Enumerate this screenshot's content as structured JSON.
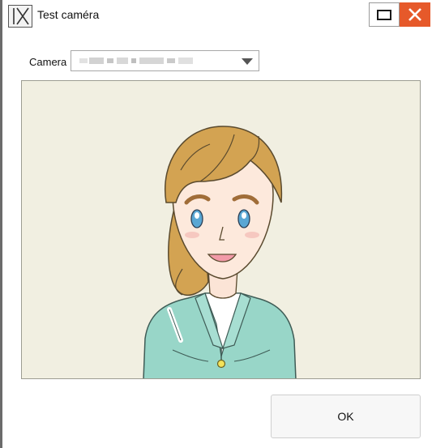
{
  "window": {
    "title": "Test caméra",
    "app_icon_label": "IX",
    "maximize_icon": "maximize-icon",
    "close_icon": "close-icon"
  },
  "camera": {
    "label": "Camera",
    "selected_value": "",
    "value_obscured": true,
    "dropdown_icon": "chevron-down-icon"
  },
  "preview": {
    "content": "camera-preview-illustration"
  },
  "actions": {
    "ok_label": "OK"
  },
  "colors": {
    "close_button": "#e6592a",
    "preview_background": "#f1efe1",
    "hair": "#d3a352",
    "jacket": "#98d6c8"
  }
}
